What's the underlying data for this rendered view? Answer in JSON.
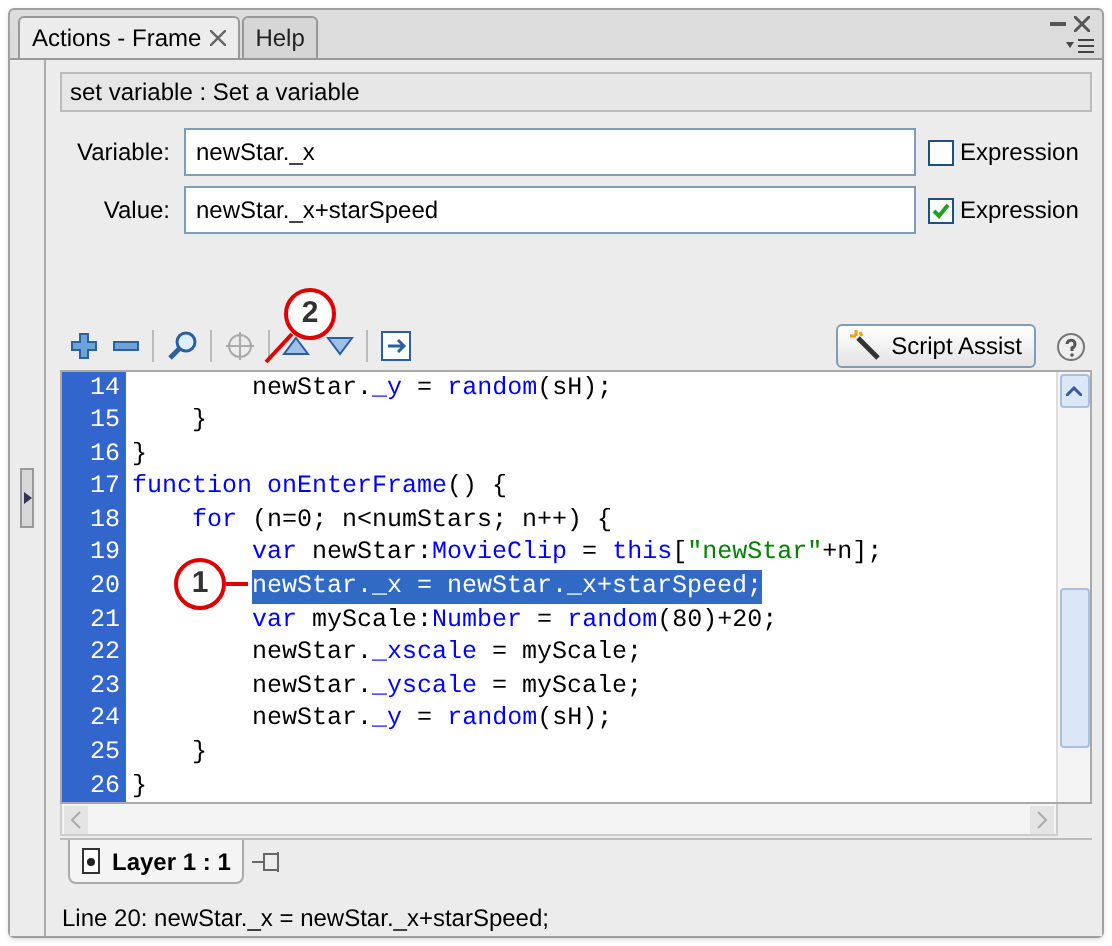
{
  "tabs": [
    {
      "label": "Actions - Frame",
      "selected": true,
      "closable": true
    },
    {
      "label": "Help",
      "selected": false,
      "closable": false
    }
  ],
  "description": "set variable : Set a variable",
  "fields": [
    {
      "label": "Variable:",
      "value": "newStar._x",
      "expression_label": "Expression",
      "expression_checked": false
    },
    {
      "label": "Value:",
      "value": "newStar._x+starSpeed",
      "expression_label": "Expression",
      "expression_checked": true
    }
  ],
  "toolbar": {
    "script_assist": "Script Assist"
  },
  "code": {
    "lines": [
      {
        "number": "14",
        "selected": false,
        "tokens": [
          {
            "text": "        newStar.",
            "kind": "plain"
          },
          {
            "text": "_y",
            "kind": "keyword"
          },
          {
            "text": " = ",
            "kind": "plain"
          },
          {
            "text": "random",
            "kind": "keyword"
          },
          {
            "text": "(sH);",
            "kind": "plain"
          }
        ]
      },
      {
        "number": "15",
        "selected": false,
        "tokens": [
          {
            "text": "    }",
            "kind": "plain"
          }
        ]
      },
      {
        "number": "16",
        "selected": false,
        "tokens": [
          {
            "text": "}",
            "kind": "plain"
          }
        ]
      },
      {
        "number": "17",
        "selected": false,
        "tokens": [
          {
            "text": "function onEnterFrame",
            "kind": "keyword"
          },
          {
            "text": "() {",
            "kind": "plain"
          }
        ]
      },
      {
        "number": "18",
        "selected": false,
        "tokens": [
          {
            "text": "    for",
            "kind": "keyword"
          },
          {
            "text": " (n=0; n<numStars; n++) {",
            "kind": "plain"
          }
        ]
      },
      {
        "number": "19",
        "selected": false,
        "tokens": [
          {
            "text": "        var",
            "kind": "keyword"
          },
          {
            "text": " newStar:",
            "kind": "plain"
          },
          {
            "text": "MovieClip",
            "kind": "keyword"
          },
          {
            "text": " = ",
            "kind": "plain"
          },
          {
            "text": "this",
            "kind": "keyword"
          },
          {
            "text": "[",
            "kind": "plain"
          },
          {
            "text": "\"newStar\"",
            "kind": "string"
          },
          {
            "text": "+n];",
            "kind": "plain"
          }
        ]
      },
      {
        "number": "20",
        "selected": true,
        "tokens": [
          {
            "text": "        newStar._x = newStar._x+starSpeed;",
            "kind": "plain"
          }
        ]
      },
      {
        "number": "21",
        "selected": false,
        "tokens": [
          {
            "text": "        var",
            "kind": "keyword"
          },
          {
            "text": " myScale:",
            "kind": "plain"
          },
          {
            "text": "Number",
            "kind": "keyword"
          },
          {
            "text": " = ",
            "kind": "plain"
          },
          {
            "text": "random",
            "kind": "keyword"
          },
          {
            "text": "(80)+20;",
            "kind": "plain"
          }
        ]
      },
      {
        "number": "22",
        "selected": false,
        "tokens": [
          {
            "text": "        newStar.",
            "kind": "plain"
          },
          {
            "text": "_xscale",
            "kind": "keyword"
          },
          {
            "text": " = myScale;",
            "kind": "plain"
          }
        ]
      },
      {
        "number": "23",
        "selected": false,
        "tokens": [
          {
            "text": "        newStar.",
            "kind": "plain"
          },
          {
            "text": "_yscale",
            "kind": "keyword"
          },
          {
            "text": " = myScale;",
            "kind": "plain"
          }
        ]
      },
      {
        "number": "24",
        "selected": false,
        "tokens": [
          {
            "text": "        newStar.",
            "kind": "plain"
          },
          {
            "text": "_y",
            "kind": "keyword"
          },
          {
            "text": " = ",
            "kind": "plain"
          },
          {
            "text": "random",
            "kind": "keyword"
          },
          {
            "text": "(sH);",
            "kind": "plain"
          }
        ]
      },
      {
        "number": "25",
        "selected": false,
        "tokens": [
          {
            "text": "    }",
            "kind": "plain"
          }
        ]
      },
      {
        "number": "26",
        "selected": false,
        "tokens": [
          {
            "text": "}",
            "kind": "plain"
          }
        ]
      }
    ]
  },
  "layer_tab": {
    "label": "Layer 1 : 1"
  },
  "status_bar": "Line 20: newStar._x = newStar._x+starSpeed;",
  "callouts": [
    {
      "label": "1"
    },
    {
      "label": "2"
    }
  ]
}
